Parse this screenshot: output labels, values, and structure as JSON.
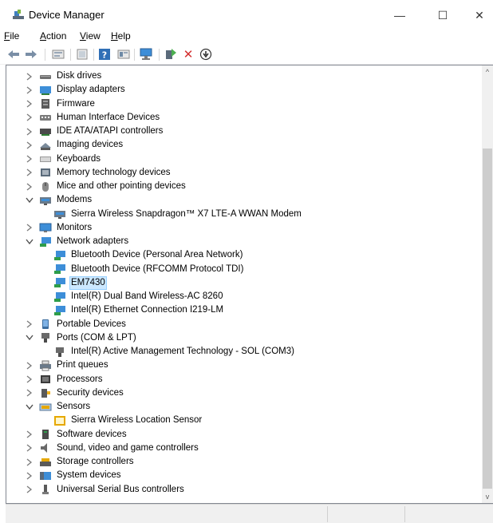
{
  "window": {
    "title": "Device Manager",
    "minimize": "—",
    "maximize": "☐",
    "close": "✕"
  },
  "menu": [
    {
      "key": "file",
      "letter": "F",
      "rest": "ile"
    },
    {
      "key": "action",
      "letter": "A",
      "rest": "ction"
    },
    {
      "key": "view",
      "letter": "V",
      "rest": "iew"
    },
    {
      "key": "help",
      "letter": "H",
      "rest": "elp"
    }
  ],
  "toolbar": [
    {
      "name": "back-arrow-icon"
    },
    {
      "name": "forward-arrow-icon"
    },
    {
      "name": "properties-icon"
    },
    {
      "name": "show-hidden-icon"
    },
    {
      "name": "help-icon",
      "glyph": "?"
    },
    {
      "name": "update-driver-icon"
    },
    {
      "name": "scan-hardware-icon"
    },
    {
      "name": "enable-device-icon"
    },
    {
      "name": "uninstall-device-icon",
      "glyph": "✕"
    },
    {
      "name": "disable-device-icon",
      "glyph": "⬇"
    }
  ],
  "tree": [
    {
      "label": "Disk drives",
      "icon": "disk-drive-icon",
      "level": 0,
      "expanded": false
    },
    {
      "label": "Display adapters",
      "icon": "display-adapter-icon",
      "level": 0,
      "expanded": false
    },
    {
      "label": "Firmware",
      "icon": "firmware-icon",
      "level": 0,
      "expanded": false
    },
    {
      "label": "Human Interface Devices",
      "icon": "hid-icon",
      "level": 0,
      "expanded": false
    },
    {
      "label": "IDE ATA/ATAPI controllers",
      "icon": "ide-controller-icon",
      "level": 0,
      "expanded": false
    },
    {
      "label": "Imaging devices",
      "icon": "imaging-device-icon",
      "level": 0,
      "expanded": false
    },
    {
      "label": "Keyboards",
      "icon": "keyboard-icon",
      "level": 0,
      "expanded": false
    },
    {
      "label": "Memory technology devices",
      "icon": "memory-device-icon",
      "level": 0,
      "expanded": false
    },
    {
      "label": "Mice and other pointing devices",
      "icon": "mouse-icon",
      "level": 0,
      "expanded": false
    },
    {
      "label": "Modems",
      "icon": "modem-icon",
      "level": 0,
      "expanded": true
    },
    {
      "label": "Sierra Wireless Snapdragon™ X7 LTE-A WWAN Modem",
      "icon": "modem-icon",
      "level": 1
    },
    {
      "label": "Monitors",
      "icon": "monitor-icon",
      "level": 0,
      "expanded": false
    },
    {
      "label": "Network adapters",
      "icon": "network-adapter-icon",
      "level": 0,
      "expanded": true
    },
    {
      "label": "Bluetooth Device (Personal Area Network)",
      "icon": "network-adapter-icon",
      "level": 1
    },
    {
      "label": "Bluetooth Device (RFCOMM Protocol TDI)",
      "icon": "network-adapter-icon",
      "level": 1
    },
    {
      "label": "EM7430",
      "icon": "network-adapter-icon",
      "level": 1,
      "selected": true
    },
    {
      "label": "Intel(R) Dual Band Wireless-AC 8260",
      "icon": "network-adapter-icon",
      "level": 1
    },
    {
      "label": "Intel(R) Ethernet Connection I219-LM",
      "icon": "network-adapter-icon",
      "level": 1
    },
    {
      "label": "Portable Devices",
      "icon": "portable-device-icon",
      "level": 0,
      "expanded": false
    },
    {
      "label": "Ports (COM & LPT)",
      "icon": "port-icon",
      "level": 0,
      "expanded": true
    },
    {
      "label": "Intel(R) Active Management Technology - SOL (COM3)",
      "icon": "port-icon",
      "level": 1
    },
    {
      "label": "Print queues",
      "icon": "printer-icon",
      "level": 0,
      "expanded": false
    },
    {
      "label": "Processors",
      "icon": "processor-icon",
      "level": 0,
      "expanded": false
    },
    {
      "label": "Security devices",
      "icon": "security-device-icon",
      "level": 0,
      "expanded": false
    },
    {
      "label": "Sensors",
      "icon": "sensor-icon",
      "level": 0,
      "expanded": true
    },
    {
      "label": "Sierra Wireless Location Sensor",
      "icon": "location-sensor-icon",
      "level": 1
    },
    {
      "label": "Software devices",
      "icon": "software-device-icon",
      "level": 0,
      "expanded": false
    },
    {
      "label": "Sound, video and game controllers",
      "icon": "sound-icon",
      "level": 0,
      "expanded": false
    },
    {
      "label": "Storage controllers",
      "icon": "storage-controller-icon",
      "level": 0,
      "expanded": false
    },
    {
      "label": "System devices",
      "icon": "system-device-icon",
      "level": 0,
      "expanded": false
    },
    {
      "label": "Universal Serial Bus controllers",
      "icon": "usb-icon",
      "level": 0,
      "expanded": false
    }
  ],
  "colors": {
    "selection_bg": "#cce8ff",
    "selection_border": "#99d1ff",
    "scrollbar_track": "#f0f0f0",
    "scrollbar_thumb": "#cdcdcd"
  }
}
